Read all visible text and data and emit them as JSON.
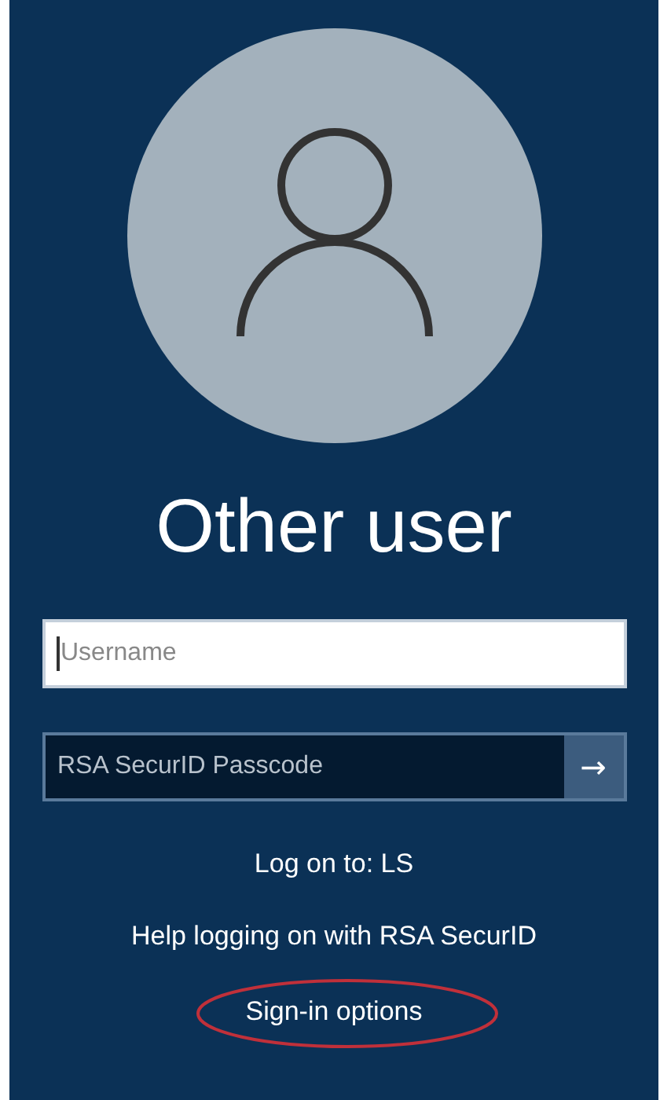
{
  "user": {
    "name": "Other user"
  },
  "username_field": {
    "placeholder": "Username",
    "focused": true
  },
  "passcode_field": {
    "placeholder": "RSA SecurID Passcode",
    "submit": "→"
  },
  "log_on_to": "Log on to: LS",
  "help_link": "Help logging on with RSA SecurID",
  "sign_in_options": {
    "label": "Sign-in options",
    "circled": true
  }
}
